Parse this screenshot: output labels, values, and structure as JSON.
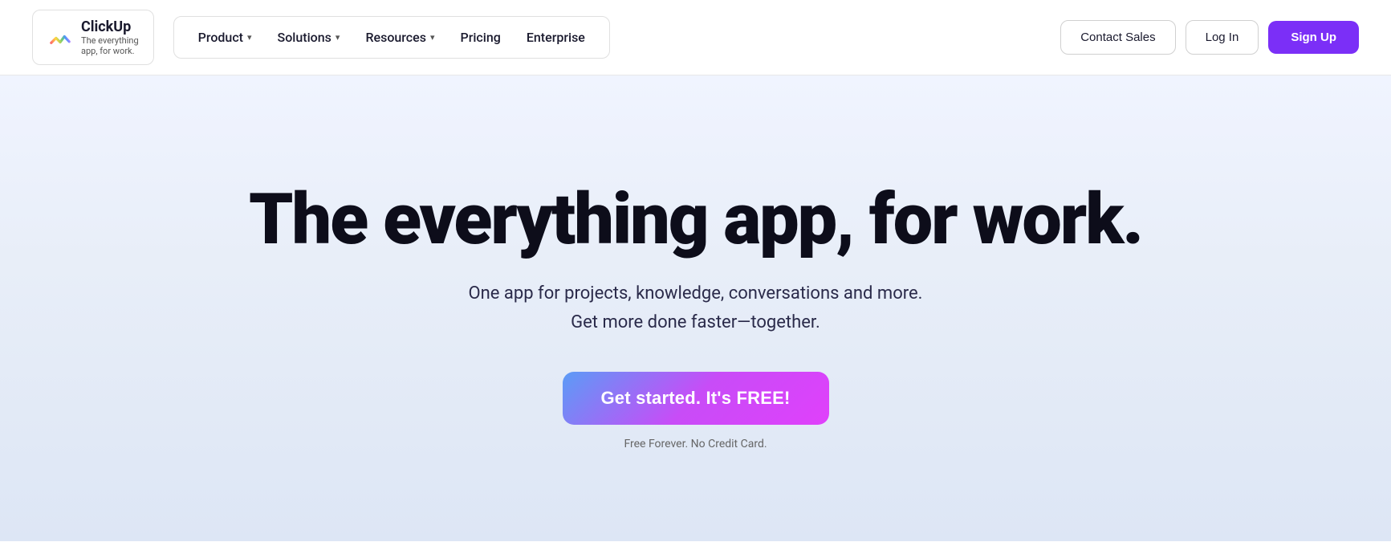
{
  "nav": {
    "logo": {
      "brand": "ClickUp",
      "tagline": "The everything\napp, for work."
    },
    "links": [
      {
        "id": "product",
        "label": "Product",
        "hasDropdown": true
      },
      {
        "id": "solutions",
        "label": "Solutions",
        "hasDropdown": true
      },
      {
        "id": "resources",
        "label": "Resources",
        "hasDropdown": true
      },
      {
        "id": "pricing",
        "label": "Pricing",
        "hasDropdown": false
      },
      {
        "id": "enterprise",
        "label": "Enterprise",
        "hasDropdown": false
      }
    ],
    "cta": {
      "contact_label": "Contact Sales",
      "login_label": "Log In",
      "signup_label": "Sign Up"
    }
  },
  "hero": {
    "title": "The everything app, for work.",
    "subtitle_line1": "One app for projects, knowledge, conversations and more.",
    "subtitle_line2": "Get more done faster—together.",
    "cta_label": "Get started. It's FREE!",
    "disclaimer": "Free Forever. No Credit Card."
  },
  "colors": {
    "signup_bg": "#7b2ff7",
    "cta_gradient_start": "#5b9cf6",
    "cta_gradient_mid": "#c84cf7",
    "cta_gradient_end": "#e040fb"
  }
}
